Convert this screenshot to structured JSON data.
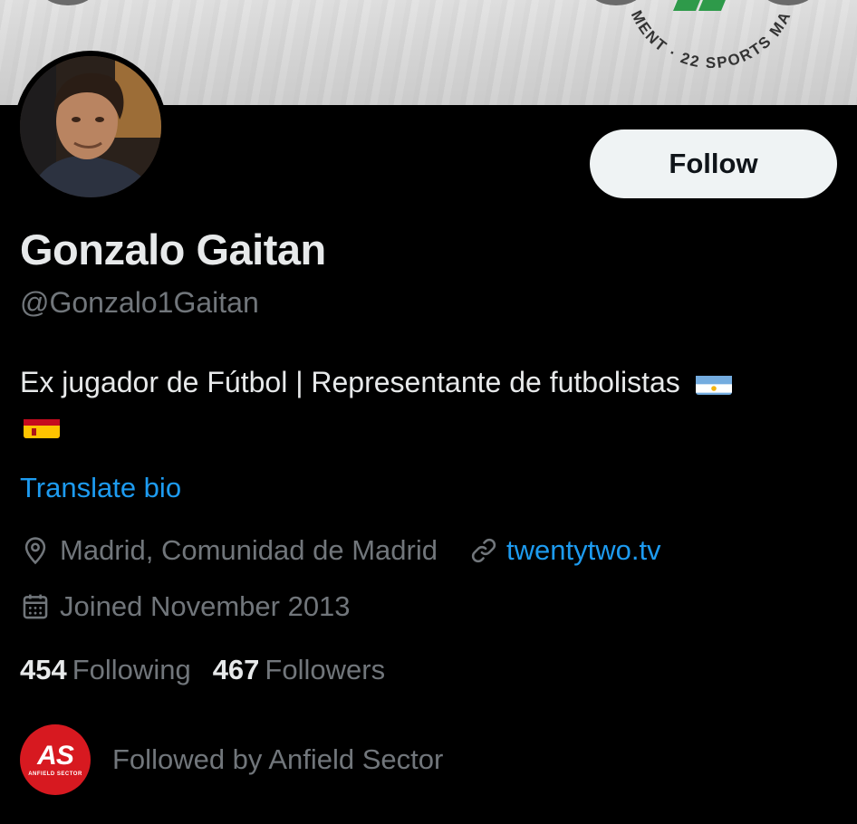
{
  "profile": {
    "display_name": "Gonzalo Gaitan",
    "handle": "@Gonzalo1Gaitan",
    "bio_text": "Ex jugador de Fútbol | Representante de futbolistas",
    "translate_label": "Translate bio",
    "location": "Madrid, Comunidad de Madrid",
    "website": "twentytwo.tv",
    "joined": "Joined November 2013",
    "follow_label": "Follow"
  },
  "stats": {
    "following_count": "454",
    "following_label": "Following",
    "followers_count": "467",
    "followers_label": "Followers"
  },
  "followed_by": {
    "text": "Followed by Anfield Sector",
    "logo_mark": "AS",
    "logo_sub": "ANFIELD SECTOR"
  },
  "banner": {
    "badge_text": "MENT · 22 SPORTS MA"
  },
  "colors": {
    "background": "#000000",
    "primary_text": "#e7e9ea",
    "secondary_text": "#71767b",
    "link": "#1d9bf0",
    "follow_button_bg": "#eff3f4",
    "brand_red": "#d71920"
  },
  "icons": [
    "location-pin-icon",
    "link-icon",
    "calendar-icon",
    "argentina-flag-icon",
    "spain-flag-icon"
  ]
}
